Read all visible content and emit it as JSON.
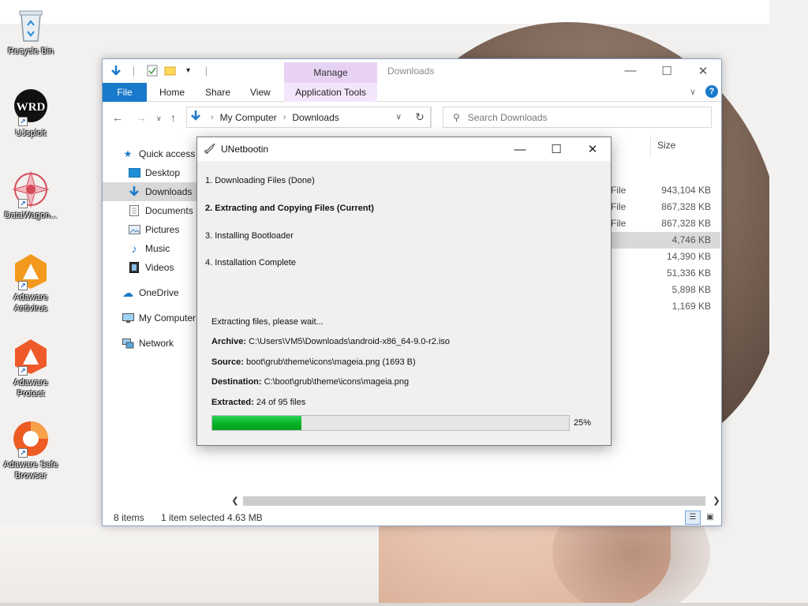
{
  "desktop": {
    "icons": [
      {
        "label": "Recycle Bin"
      },
      {
        "label": "UJsploit"
      },
      {
        "label": "DataWagon..."
      },
      {
        "label": "Adaware Antivirus"
      },
      {
        "label": "Adaware Protect"
      },
      {
        "label": "Adaware Safe Browser"
      }
    ]
  },
  "explorer": {
    "window_title": "Downloads",
    "contextual_tab": "Manage",
    "ribbon_tabs": [
      "File",
      "Home",
      "Share",
      "View",
      "Application Tools"
    ],
    "address": {
      "root": "My Computer",
      "current": "Downloads"
    },
    "search_placeholder": "Search Downloads",
    "nav": {
      "quick_access": "Quick access",
      "desktop": "Desktop",
      "downloads": "Downloads",
      "documents": "Documents",
      "pictures": "Pictures",
      "music": "Music",
      "videos": "Videos",
      "onedrive": "OneDrive",
      "my_computer": "My Computer",
      "network": "Network"
    },
    "size_column": "Size",
    "files": [
      {
        "type": "File",
        "size": "943,104 KB"
      },
      {
        "type": "File",
        "size": "867,328 KB"
      },
      {
        "type": "File",
        "size": "867,328 KB"
      },
      {
        "type": "",
        "size": "4,746 KB",
        "selected": true
      },
      {
        "type": "",
        "size": "14,390 KB"
      },
      {
        "type": "",
        "size": "51,336 KB"
      },
      {
        "type": "",
        "size": "5,898 KB"
      },
      {
        "type": "",
        "size": "1,169 KB"
      }
    ],
    "status": {
      "items": "8 items",
      "selected": "1 item selected",
      "size": "4.63 MB"
    }
  },
  "unetbootin": {
    "title": "UNetbootin",
    "steps": [
      "1. Downloading Files (Done)",
      "2. Extracting and Copying Files (Current)",
      "3. Installing Bootloader",
      "4. Installation Complete"
    ],
    "status_line": "Extracting files, please wait...",
    "archive_label": "Archive:",
    "archive_value": "C:\\Users\\VM5\\Downloads\\android-x86_64-9.0-r2.iso",
    "source_label": "Source:",
    "source_value": "boot\\grub\\theme\\icons\\mageia.png (1693 B)",
    "destination_label": "Destination:",
    "destination_value": "C:\\boot\\grub\\theme\\icons\\mageia.png",
    "extracted_label": "Extracted:",
    "extracted_value": "24 of 95 files",
    "progress_fraction": 0.25,
    "progress_text": "25%",
    "progress_color": "#06b025"
  },
  "icons": {
    "recycle": "recycle-bin-icon",
    "minimize": "minimize-icon",
    "maximize": "maximize-icon",
    "close": "close-icon"
  }
}
